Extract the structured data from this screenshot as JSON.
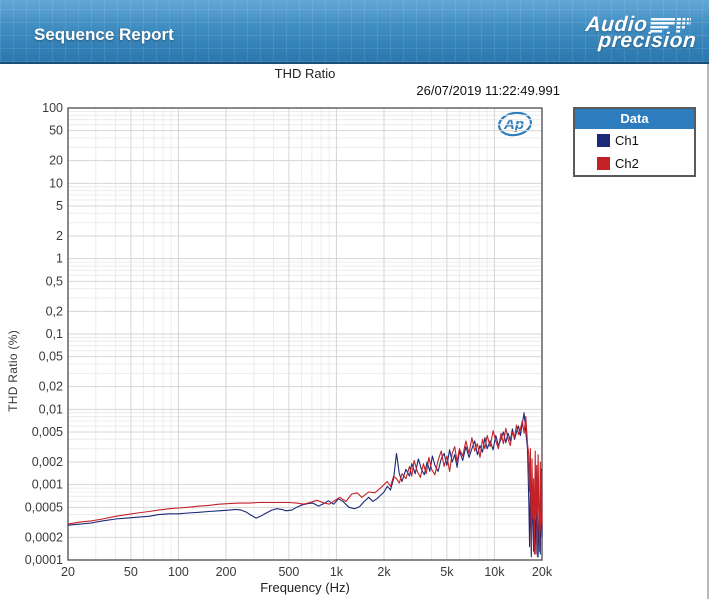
{
  "header": {
    "title": "Sequence Report",
    "logo_line1": "Audio",
    "logo_line2": "precision"
  },
  "report": {
    "title": "THD Ratio",
    "timestamp": "26/07/2019 11:22:49.991",
    "ap_mark": "Ap"
  },
  "legend": {
    "title": "Data",
    "items": [
      {
        "label": "Ch1",
        "color": "#1b2a78"
      },
      {
        "label": "Ch2",
        "color": "#c42127"
      }
    ]
  },
  "chart_data": {
    "type": "line",
    "title": "THD Ratio",
    "xlabel": "Frequency (Hz)",
    "ylabel": "THD Ratio (%)",
    "xscale": "log",
    "yscale": "log",
    "xlim": [
      20,
      20000
    ],
    "ylim": [
      0.0001,
      100
    ],
    "grid": true,
    "legend_position": "outside-right",
    "xticks": {
      "values": [
        20,
        50,
        100,
        200,
        500,
        1000,
        2000,
        5000,
        10000,
        20000
      ],
      "labels": [
        "20",
        "50",
        "100",
        "200",
        "500",
        "1k",
        "2k",
        "5k",
        "10k",
        "20k"
      ]
    },
    "yticks": {
      "values": [
        100,
        50,
        20,
        10,
        5,
        2,
        1,
        0.5,
        0.2,
        0.1,
        0.05,
        0.02,
        0.01,
        0.005,
        0.002,
        0.001,
        0.0005,
        0.0002,
        0.0001
      ],
      "labels": [
        "100",
        "50",
        "20",
        "10",
        "5",
        "2",
        "1",
        "0,5",
        "0,2",
        "0,1",
        "0,05",
        "0,02",
        "0,01",
        "0,005",
        "0,002",
        "0,001",
        "0,0005",
        "0,0002",
        "0,0001"
      ]
    },
    "series": [
      {
        "name": "Ch1",
        "color": "#1b2a78",
        "points": [
          [
            20,
            0.00029
          ],
          [
            24,
            0.0003
          ],
          [
            28,
            0.00031
          ],
          [
            33,
            0.00033
          ],
          [
            40,
            0.00035
          ],
          [
            47,
            0.00036
          ],
          [
            55,
            0.00037
          ],
          [
            65,
            0.00038
          ],
          [
            75,
            0.0004
          ],
          [
            88,
            0.00041
          ],
          [
            100,
            0.00041
          ],
          [
            115,
            0.00042
          ],
          [
            135,
            0.00043
          ],
          [
            155,
            0.00044
          ],
          [
            180,
            0.00045
          ],
          [
            210,
            0.00046
          ],
          [
            230,
            0.00047
          ],
          [
            250,
            0.00046
          ],
          [
            270,
            0.00043
          ],
          [
            290,
            0.00039
          ],
          [
            310,
            0.00036
          ],
          [
            330,
            0.00038
          ],
          [
            360,
            0.00042
          ],
          [
            390,
            0.00046
          ],
          [
            420,
            0.00048
          ],
          [
            450,
            0.00047
          ],
          [
            480,
            0.00045
          ],
          [
            520,
            0.00046
          ],
          [
            560,
            0.0005
          ],
          [
            610,
            0.00054
          ],
          [
            660,
            0.00056
          ],
          [
            710,
            0.00057
          ],
          [
            770,
            0.00052
          ],
          [
            830,
            0.00056
          ],
          [
            890,
            0.00061
          ],
          [
            960,
            0.00055
          ],
          [
            1030,
            0.00065
          ],
          [
            1100,
            0.0006
          ],
          [
            1200,
            0.0005
          ],
          [
            1300,
            0.00048
          ],
          [
            1400,
            0.00051
          ],
          [
            1500,
            0.0006
          ],
          [
            1600,
            0.00068
          ],
          [
            1700,
            0.0006
          ],
          [
            1800,
            0.00065
          ],
          [
            1900,
            0.00072
          ],
          [
            2000,
            0.0008
          ],
          [
            2100,
            0.00095
          ],
          [
            2200,
            0.00085
          ],
          [
            2300,
            0.0012
          ],
          [
            2400,
            0.0026
          ],
          [
            2500,
            0.0014
          ],
          [
            2600,
            0.0011
          ],
          [
            2750,
            0.0016
          ],
          [
            2900,
            0.0013
          ],
          [
            3000,
            0.0019
          ],
          [
            3150,
            0.0014
          ],
          [
            3300,
            0.0022
          ],
          [
            3450,
            0.0016
          ],
          [
            3600,
            0.00135
          ],
          [
            3750,
            0.002
          ],
          [
            3900,
            0.0015
          ],
          [
            4050,
            0.0024
          ],
          [
            4200,
            0.0018
          ],
          [
            4400,
            0.0015
          ],
          [
            4600,
            0.0022
          ],
          [
            4800,
            0.0026
          ],
          [
            5000,
            0.0018
          ],
          [
            5200,
            0.0029
          ],
          [
            5400,
            0.002
          ],
          [
            5600,
            0.0025
          ],
          [
            5800,
            0.0017
          ],
          [
            6000,
            0.0028
          ],
          [
            6300,
            0.0021
          ],
          [
            6600,
            0.0032
          ],
          [
            6900,
            0.0023
          ],
          [
            7200,
            0.003
          ],
          [
            7500,
            0.0038
          ],
          [
            7800,
            0.0025
          ],
          [
            8100,
            0.0033
          ],
          [
            8400,
            0.0027
          ],
          [
            8700,
            0.0042
          ],
          [
            9000,
            0.003
          ],
          [
            9400,
            0.0038
          ],
          [
            9800,
            0.0029
          ],
          [
            10200,
            0.0045
          ],
          [
            10600,
            0.0033
          ],
          [
            11000,
            0.004
          ],
          [
            11400,
            0.005
          ],
          [
            11800,
            0.0036
          ],
          [
            12200,
            0.0048
          ],
          [
            12600,
            0.0038
          ],
          [
            13000,
            0.0055
          ],
          [
            13400,
            0.004
          ],
          [
            13800,
            0.005
          ],
          [
            14200,
            0.006
          ],
          [
            14600,
            0.0045
          ],
          [
            15000,
            0.0065
          ],
          [
            15400,
            0.009
          ],
          [
            15800,
            0.005
          ],
          [
            16200,
            0.003
          ],
          [
            16500,
            0.0006
          ],
          [
            16700,
            0.00015
          ],
          [
            16900,
            0.0012
          ],
          [
            17100,
            0.00011
          ],
          [
            17400,
            0.0009
          ],
          [
            17700,
            0.00013
          ],
          [
            18000,
            0.0007
          ],
          [
            18300,
            0.00012
          ],
          [
            18600,
            0.001
          ],
          [
            18900,
            0.00011
          ],
          [
            19200,
            0.0005
          ],
          [
            19500,
            0.00012
          ],
          [
            19800,
            0.0016
          ],
          [
            20000,
            0.0002
          ]
        ]
      },
      {
        "name": "Ch2",
        "color": "#c42127",
        "points": [
          [
            20,
            0.0003
          ],
          [
            24,
            0.00032
          ],
          [
            28,
            0.00033
          ],
          [
            33,
            0.00035
          ],
          [
            40,
            0.00038
          ],
          [
            47,
            0.0004
          ],
          [
            55,
            0.00042
          ],
          [
            65,
            0.00044
          ],
          [
            75,
            0.00046
          ],
          [
            88,
            0.00048
          ],
          [
            100,
            0.00049
          ],
          [
            115,
            0.0005
          ],
          [
            135,
            0.00052
          ],
          [
            155,
            0.00053
          ],
          [
            180,
            0.00055
          ],
          [
            210,
            0.00056
          ],
          [
            240,
            0.00057
          ],
          [
            280,
            0.00057
          ],
          [
            320,
            0.00058
          ],
          [
            370,
            0.00058
          ],
          [
            430,
            0.00058
          ],
          [
            500,
            0.00058
          ],
          [
            560,
            0.00057
          ],
          [
            620,
            0.00055
          ],
          [
            680,
            0.00058
          ],
          [
            750,
            0.00062
          ],
          [
            820,
            0.00058
          ],
          [
            900,
            0.00055
          ],
          [
            980,
            0.00062
          ],
          [
            1050,
            0.00068
          ],
          [
            1150,
            0.0006
          ],
          [
            1250,
            0.00075
          ],
          [
            1350,
            0.00078
          ],
          [
            1450,
            0.00068
          ],
          [
            1600,
            0.0008
          ],
          [
            1750,
            0.00078
          ],
          [
            1900,
            0.0009
          ],
          [
            2000,
            0.001
          ],
          [
            2100,
            0.0011
          ],
          [
            2200,
            0.00095
          ],
          [
            2300,
            0.0013
          ],
          [
            2400,
            0.0012
          ],
          [
            2500,
            0.00105
          ],
          [
            2600,
            0.0014
          ],
          [
            2750,
            0.0012
          ],
          [
            2900,
            0.00175
          ],
          [
            3000,
            0.0013
          ],
          [
            3100,
            0.0021
          ],
          [
            3250,
            0.0015
          ],
          [
            3400,
            0.00125
          ],
          [
            3550,
            0.0019
          ],
          [
            3700,
            0.0014
          ],
          [
            3850,
            0.0023
          ],
          [
            4000,
            0.0016
          ],
          [
            4200,
            0.00135
          ],
          [
            4400,
            0.0021
          ],
          [
            4600,
            0.0028
          ],
          [
            4800,
            0.00175
          ],
          [
            5000,
            0.0024
          ],
          [
            5200,
            0.0015
          ],
          [
            5400,
            0.0026
          ],
          [
            5600,
            0.0032
          ],
          [
            5800,
            0.002
          ],
          [
            6000,
            0.003
          ],
          [
            6300,
            0.0024
          ],
          [
            6600,
            0.0038
          ],
          [
            6900,
            0.0026
          ],
          [
            7200,
            0.0042
          ],
          [
            7500,
            0.0028
          ],
          [
            7800,
            0.0035
          ],
          [
            8100,
            0.0023
          ],
          [
            8400,
            0.004
          ],
          [
            8700,
            0.003
          ],
          [
            9000,
            0.0045
          ],
          [
            9400,
            0.0032
          ],
          [
            9800,
            0.0052
          ],
          [
            10200,
            0.0038
          ],
          [
            10600,
            0.003
          ],
          [
            11000,
            0.0048
          ],
          [
            11400,
            0.0035
          ],
          [
            11800,
            0.0056
          ],
          [
            12200,
            0.004
          ],
          [
            12600,
            0.0033
          ],
          [
            13000,
            0.005
          ],
          [
            13400,
            0.0042
          ],
          [
            13800,
            0.0062
          ],
          [
            14200,
            0.0046
          ],
          [
            14600,
            0.0055
          ],
          [
            15000,
            0.007
          ],
          [
            15400,
            0.0048
          ],
          [
            15800,
            0.008
          ],
          [
            16200,
            0.0035
          ],
          [
            16500,
            0.0025
          ],
          [
            16700,
            0.0008
          ],
          [
            16900,
            0.003
          ],
          [
            17100,
            0.00015
          ],
          [
            17300,
            0.0022
          ],
          [
            17500,
            0.00035
          ],
          [
            17700,
            0.0012
          ],
          [
            17900,
            0.00012
          ],
          [
            18100,
            0.0028
          ],
          [
            18300,
            0.0004
          ],
          [
            18500,
            0.0018
          ],
          [
            18700,
            0.00011
          ],
          [
            18900,
            0.0025
          ],
          [
            19100,
            0.0006
          ],
          [
            19300,
            0.00013
          ],
          [
            19500,
            0.002
          ],
          [
            19700,
            0.00025
          ],
          [
            19850,
            0.0015
          ],
          [
            20000,
            0.0003
          ]
        ]
      }
    ]
  }
}
